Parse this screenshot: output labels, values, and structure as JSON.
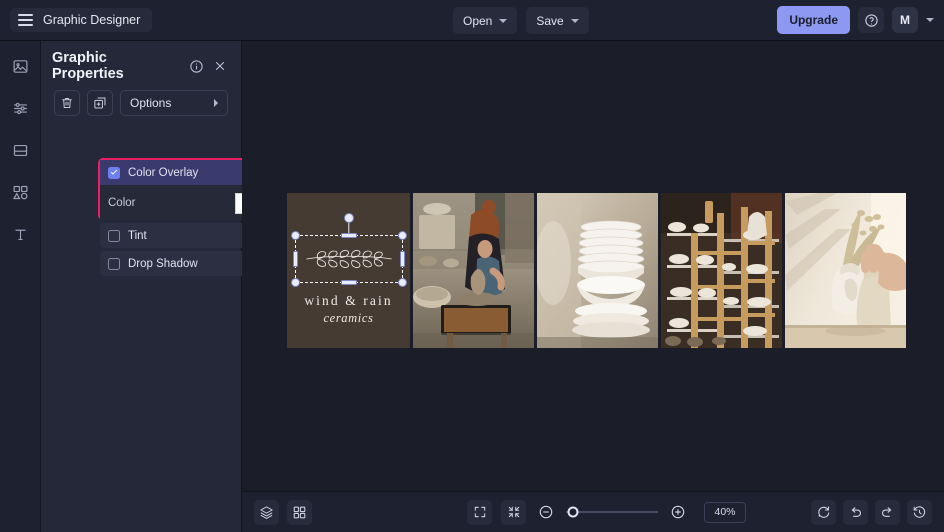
{
  "app": {
    "name": "Graphic Designer",
    "menu_icon": "hamburger-icon"
  },
  "topbar": {
    "open_label": "Open",
    "save_label": "Save",
    "upgrade_label": "Upgrade",
    "help_icon": "help-circle-icon",
    "avatar_initial": "M",
    "account_chevron": "chevron-down-icon"
  },
  "rail": {
    "items": [
      {
        "name": "image-tool",
        "icon": "image-icon"
      },
      {
        "name": "adjustments-tool",
        "icon": "sliders-icon"
      },
      {
        "name": "layout-tool",
        "icon": "layout-icon"
      },
      {
        "name": "shapes-tool",
        "icon": "shapes-icon"
      },
      {
        "name": "text-tool",
        "icon": "text-icon"
      }
    ]
  },
  "panel": {
    "title": "Graphic Properties",
    "info_icon": "info-icon",
    "close_icon": "close-icon",
    "delete_icon": "trash-icon",
    "duplicate_icon": "duplicate-icon",
    "options_label": "Options",
    "options_chevron": "chevron-right-icon",
    "highlight_color": "#ec1e64",
    "sections": [
      {
        "label": "Color Overlay",
        "checked": true,
        "expanded": true,
        "chevron": "chevron-up-icon",
        "highlighted": true,
        "field_label": "Color",
        "swatch_color": "#ffffff"
      },
      {
        "label": "Tint",
        "checked": false,
        "expanded": false,
        "chevron": "chevron-down-icon",
        "highlighted": false
      },
      {
        "label": "Drop Shadow",
        "checked": false,
        "expanded": false,
        "chevron": "chevron-down-icon",
        "highlighted": false
      }
    ]
  },
  "canvas": {
    "logo": {
      "line1": "wind & rain",
      "line2": "ceramics",
      "ornament": "laurel-branch",
      "background": "#453b33"
    },
    "selection": {
      "active": true,
      "handle_color": "#e9ecfb",
      "rotation_handle": true
    },
    "photos": [
      {
        "name": "potter-at-wheel"
      },
      {
        "name": "stacked-white-bowls"
      },
      {
        "name": "pottery-shelves"
      },
      {
        "name": "hand-with-vase"
      }
    ]
  },
  "bottombar": {
    "layers_icon": "layers-icon",
    "grid_icon": "grid-icon",
    "fit_icon": "fit-to-screen-icon",
    "fullscreen_icon": "collapse-icon",
    "zoom_out_icon": "minus-circle-icon",
    "zoom_in_icon": "plus-circle-icon",
    "zoom_value": "40%",
    "zoom_slider_percent": 8,
    "reset_icon": "reset-icon",
    "undo_icon": "undo-icon",
    "redo_icon": "redo-icon",
    "history_icon": "history-icon"
  }
}
